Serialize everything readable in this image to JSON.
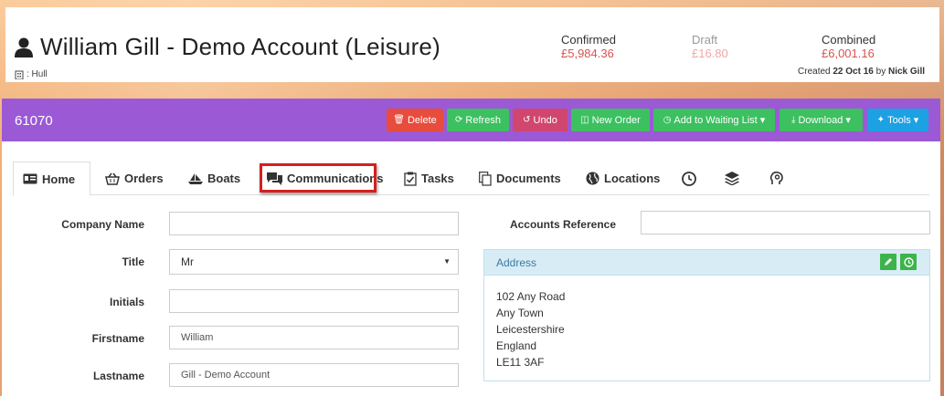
{
  "header": {
    "title": "William Gill - Demo Account (Leisure)",
    "location": ": Hull",
    "stats": {
      "confirmed_label": "Confirmed",
      "confirmed_value": "£5,984.36",
      "draft_label": "Draft",
      "draft_value": "£16.80",
      "combined_label": "Combined",
      "combined_value": "£6,001.16"
    },
    "created_prefix": "Created",
    "created_date": "22 Oct 16",
    "created_by_word": "by",
    "created_by": "Nick Gill"
  },
  "toolbar": {
    "record_id": "61070",
    "buttons": {
      "delete": "Delete",
      "refresh": "Refresh",
      "undo": "Undo",
      "new_order": "New Order",
      "waiting_list": "Add to Waiting List ▾",
      "download": "Download ▾",
      "tools": "Tools ▾"
    },
    "colors": {
      "toolbar_bg": "#9b59d6",
      "delete": "#e74c3c",
      "green": "#3cc060",
      "undo": "#d0466e",
      "tools": "#1ca1e3"
    }
  },
  "tabs": {
    "home": "Home",
    "orders": "Orders",
    "boats": "Boats",
    "communications": "Communications",
    "tasks": "Tasks",
    "documents": "Documents",
    "locations": "Locations"
  },
  "form": {
    "company_name_label": "Company Name",
    "company_name_value": "",
    "title_label": "Title",
    "title_value": "Mr",
    "initials_label": "Initials",
    "initials_value": "",
    "firstname_label": "Firstname",
    "firstname_value": "William",
    "lastname_label": "Lastname",
    "lastname_value": "Gill - Demo Account",
    "accounts_reference_label": "Accounts Reference",
    "accounts_reference_value": ""
  },
  "address": {
    "heading": "Address",
    "lines": [
      "102 Any Road",
      "Any Town",
      "Leicestershire",
      "England",
      "LE11 3AF"
    ]
  }
}
